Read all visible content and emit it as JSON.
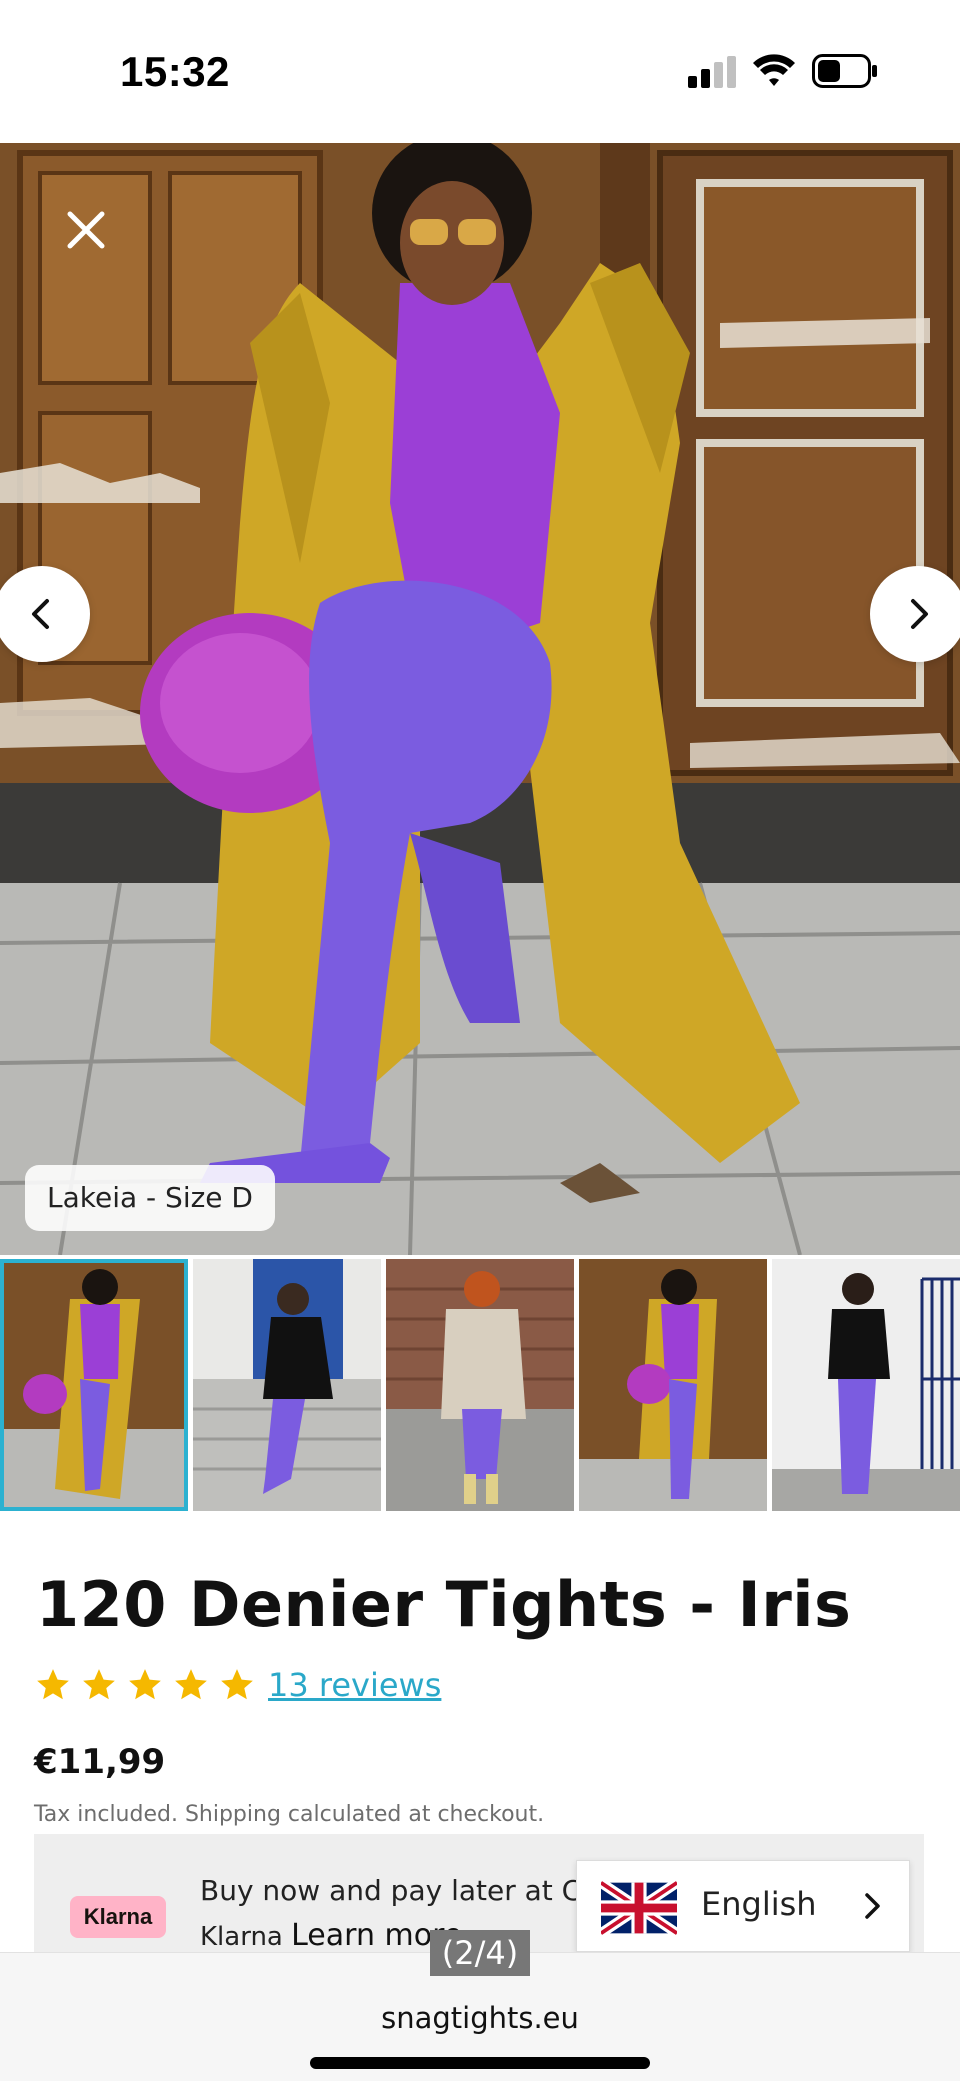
{
  "status_bar": {
    "time": "15:32",
    "icons": [
      "cellular-signal-icon",
      "wifi-icon",
      "battery-icon"
    ]
  },
  "gallery": {
    "close_icon": "close-icon",
    "prev_icon": "chevron-left-icon",
    "next_icon": "chevron-right-icon",
    "caption": "Lakeia - Size D",
    "image_counter": "(2/4)",
    "thumbnail_count": 5,
    "active_thumbnail": 0
  },
  "product": {
    "title": "120 Denier Tights - Iris",
    "rating_stars": 5,
    "reviews_link": "13 reviews",
    "price": "€11,99",
    "tax_note": "Tax included. Shipping calculated at checkout."
  },
  "klarna": {
    "badge": "Klarna",
    "line1": "Buy now and pay later at C",
    "line2_prefix": "Klarna",
    "learn_more": "Learn more"
  },
  "language_selector": {
    "label": "English",
    "flag_icon": "uk-flag-icon",
    "chevron_icon": "chevron-right-icon"
  },
  "browser": {
    "url": "snagtights.eu"
  },
  "colors": {
    "accent": "#2cb1d0",
    "link": "#2aa8c9",
    "star": "#f5b800",
    "klarna_pink": "#ffb3c7",
    "tights_purple": "#7b5ce0",
    "coat_yellow": "#cfa726"
  }
}
